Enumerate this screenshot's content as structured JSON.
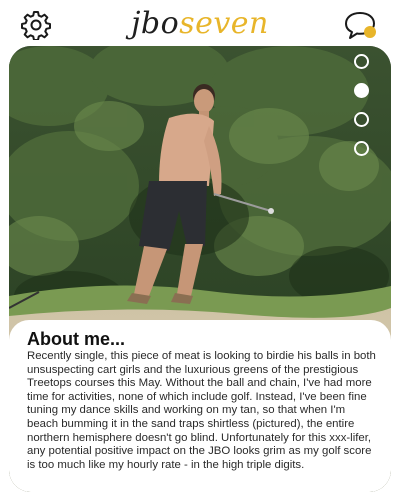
{
  "header": {
    "brand_part1": "jbo",
    "brand_part2": "seven",
    "settings_icon": "gear-icon",
    "chat_icon": "chat-bubble-icon",
    "brand_colors": {
      "jbo": "#1f1f1f",
      "seven": "#e8b52a"
    },
    "chat_badge_color": "#e8b52a"
  },
  "profile": {
    "photo_description": "shirtless man in dark shorts swinging a golf club in front of green bushes and a sand trap",
    "carousel": {
      "total": 4,
      "active_index": 1
    }
  },
  "about": {
    "title": "About me...",
    "body": "Recently single, this piece of meat is looking to birdie his balls in both unsuspecting cart girls and the luxurious greens of the prestigious Treetops courses this May. Without the ball and chain, I've had more time for activities, none of which include golf. Instead, I've been fine tuning my dance skills and working on my tan, so that when I'm beach bumming it in the sand traps shirtless (pictured), the entire northern hemisphere doesn't go blind. Unfortunately for this xxx-lifer, any potential positive impact on the JBO looks grim as my golf score is too much like my hourly rate - in the high triple digits."
  }
}
